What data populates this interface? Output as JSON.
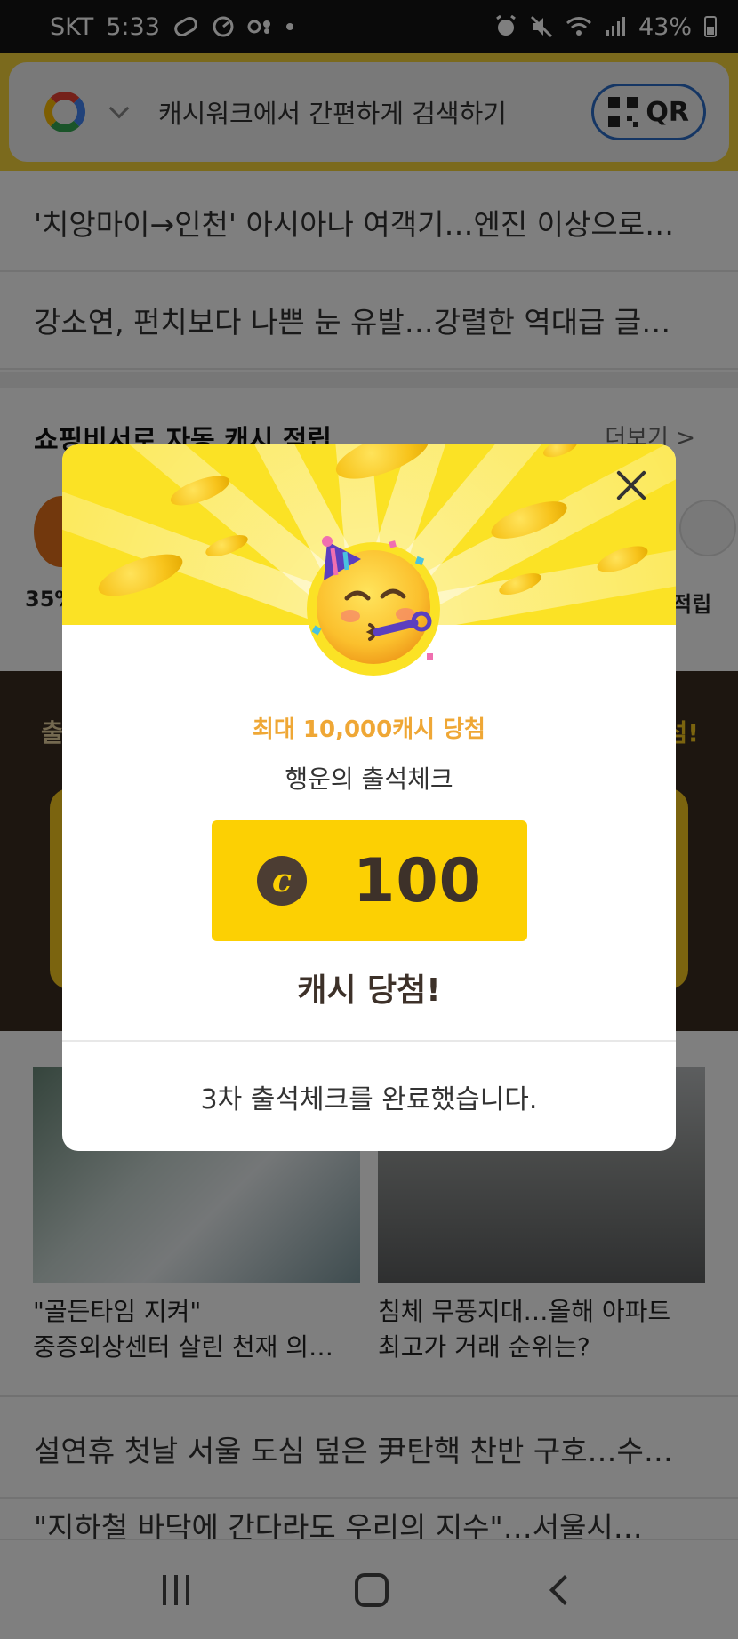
{
  "status_bar": {
    "carrier": "SKT",
    "time": "5:33",
    "battery": "43%"
  },
  "search": {
    "placeholder": "캐시워크에서 간편하게 검색하기",
    "qr_label": "QR"
  },
  "news": [
    "'치앙마이→인천' 아시아나 여객기…엔진 이상으로…",
    "강소연, 펀치보다 나쁜 눈 유발…강렬한 역대급 글…"
  ],
  "shopping": {
    "title": "쇼핑비서로 자동 캐시 적립",
    "more": "더보기 >",
    "left_item": "35%",
    "right_item": "적립"
  },
  "promo_band": {
    "left": "출",
    "right": "섬!"
  },
  "photo_news": [
    {
      "caption": "\"골든타임 지켜\"\n중증외상센터 살린 천재 의…"
    },
    {
      "caption": "침체 무풍지대…올해 아파트\n최고가 거래 순위는?"
    }
  ],
  "bottom_news": [
    "설연휴 첫날 서울 도심 덮은 尹탄핵 찬반 구호…수…",
    "\"지하철 바닥에 간다라도 우리의 지수\"…서울시…"
  ],
  "modal": {
    "win_note": "최대 10,000캐시 당첨",
    "title": "행운의 출석체크",
    "coin_symbol": "c",
    "cash_amount": "100",
    "won_label": "캐시 당첨!",
    "footer": "3차 출석체크를 완료했습니다.",
    "hero_icon": "partying-face-emoji",
    "accent": "#fcd003"
  },
  "colors": {
    "brand_yellow": "#f7d53b",
    "modal_accent_text": "#efa735",
    "dark_text": "#3d3129"
  }
}
